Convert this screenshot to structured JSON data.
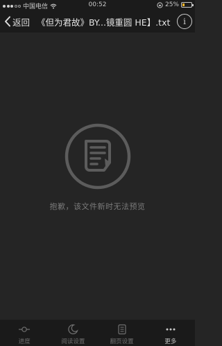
{
  "status_bar": {
    "carrier": "中国电信",
    "time": "00:52",
    "battery_percent": "25%",
    "battery_level": 0.25,
    "battery_color": "#f2b329"
  },
  "header": {
    "back_label": "返回",
    "title": "《但为君故》BY...镜重圆 HE】.txt",
    "info_label": "i"
  },
  "main": {
    "empty_message": "抱歉，该文件新时无法预览",
    "icon": "document-icon"
  },
  "toolbar": {
    "items": [
      {
        "label": "进度",
        "icon": "progress-icon"
      },
      {
        "label": "阅读设置",
        "icon": "moon-icon"
      },
      {
        "label": "翻页设置",
        "icon": "page-icon"
      },
      {
        "label": "更多",
        "icon": "more-icon"
      }
    ]
  }
}
